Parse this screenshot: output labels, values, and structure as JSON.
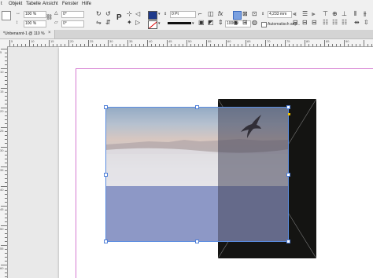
{
  "menu": {
    "items": [
      "t",
      "Objekt",
      "Tabelle",
      "Ansicht",
      "Fenster",
      "Hilfe"
    ]
  },
  "control": {
    "scale_x": "100 %",
    "scale_y": "100 %",
    "rotate": "0°",
    "shear": "0°",
    "stroke_weight": "0 Pt",
    "width_value": "4,233 mm",
    "percent": "100 %",
    "autofit_label": "Automatisch anp...",
    "fill_color": "#1f3a8a",
    "stroke_color": "#ffffff",
    "icons": [
      "rotate-icon",
      "flip-icon",
      "text-frame-icon",
      "align-icon",
      "effects-icon",
      "fit-icon",
      "distribute-icon"
    ]
  },
  "tab": {
    "label": "*Unbenannt-1 @ 110 %",
    "close": "×"
  },
  "ruler": {
    "top_labels": [
      "5",
      "10",
      "15",
      "20",
      "25",
      "30",
      "35",
      "40",
      "45",
      "50",
      "55",
      "60",
      "65",
      "70",
      "75",
      "80",
      "85",
      "90"
    ],
    "left_labels": [
      "5",
      "10",
      "15",
      "20",
      "25",
      "30",
      "35",
      "40",
      "45",
      "50",
      "55",
      "60",
      "65",
      "70"
    ]
  },
  "colors": {
    "selection": "#5b8de0",
    "margin_guide": "#d47ad0",
    "blue_block": "#8d98c6",
    "dark_frame": "#141412"
  }
}
